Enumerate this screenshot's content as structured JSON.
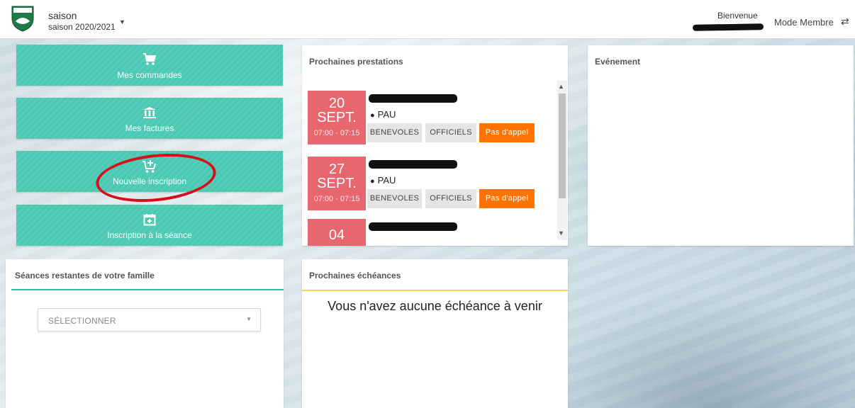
{
  "header": {
    "season_label": "saison",
    "season_value": "saison 2020/2021",
    "welcome": "Bienvenue",
    "mode_label": "Mode Membre",
    "logo_icon": "club-shield-icon"
  },
  "tiles": [
    {
      "label": "Mes commandes",
      "icon": "cart-icon"
    },
    {
      "label": "Mes factures",
      "icon": "bank-icon"
    },
    {
      "label": "Nouvelle inscription",
      "icon": "cart-add-icon"
    },
    {
      "label": "Inscription à la séance",
      "icon": "calendar-plus-icon"
    }
  ],
  "prestations": {
    "title": "Prochaines prestations",
    "items": [
      {
        "day": "20",
        "month": "SEPT.",
        "time": "07:00 - 07:15",
        "location": "PAU",
        "chips": [
          "BENEVOLES",
          "OFFICIELS",
          "Pas d'appel"
        ]
      },
      {
        "day": "27",
        "month": "SEPT.",
        "time": "07:00 - 07:15",
        "location": "PAU",
        "chips": [
          "BENEVOLES",
          "OFFICIELS",
          "Pas d'appel"
        ]
      },
      {
        "day": "04"
      }
    ]
  },
  "evenement": {
    "title": "Evénement"
  },
  "seances": {
    "title": "Séances restantes de votre famille",
    "select_placeholder": "SÉLECTIONNER"
  },
  "echeances": {
    "title": "Prochaines échéances",
    "empty_message": "Vous n'avez aucune échéance à venir"
  },
  "colors": {
    "teal": "#4cc8b2",
    "date_badge": "#e8666e",
    "orange_chip": "#ff7300",
    "annotation_red": "#d4111b"
  }
}
